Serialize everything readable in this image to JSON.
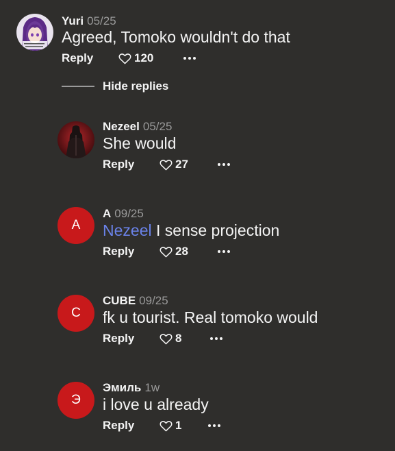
{
  "theme": {
    "background": "#2f2e2c",
    "avatar_red": "#c8191b",
    "mention_color": "#6a82e8",
    "date_color": "#9a9a9a"
  },
  "labels": {
    "reply": "Reply",
    "hide_replies": "Hide replies",
    "more_icon": "ellipsis-icon",
    "like_icon": "heart-outline-icon"
  },
  "comments": [
    {
      "username": "Yuri",
      "date": "05/25",
      "avatar": {
        "type": "image",
        "description": "anime-girl-purple-hair"
      },
      "text": "Agreed, Tomoko wouldn't do that",
      "likes": "120"
    },
    {
      "username": "Nezeel",
      "date": "05/25",
      "avatar": {
        "type": "image",
        "description": "dark-figure-red-background"
      },
      "text": "She would",
      "likes": "27"
    },
    {
      "username": "A",
      "date": "09/25",
      "avatar": {
        "type": "letter",
        "letter": "A"
      },
      "mention": "Nezeel",
      "text": "I sense projection",
      "likes": "28"
    },
    {
      "username": "CUBE",
      "date": "09/25",
      "avatar": {
        "type": "letter",
        "letter": "C"
      },
      "text": "fk u tourist. Real tomoko would",
      "likes": "8"
    },
    {
      "username": "Эмиль",
      "date": "1w",
      "avatar": {
        "type": "letter",
        "letter": "Э"
      },
      "text": "i love u already",
      "likes": "1"
    }
  ]
}
